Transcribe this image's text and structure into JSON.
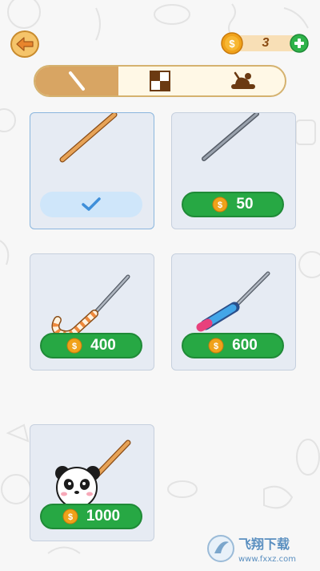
{
  "header": {
    "coin_count": "3"
  },
  "tabs": [
    {
      "icon": "toothpick-icon",
      "active": true
    },
    {
      "icon": "checker-pattern-icon",
      "active": false
    },
    {
      "icon": "food-plate-icon",
      "active": false
    }
  ],
  "items": [
    {
      "name": "wooden-stick",
      "selected": true
    },
    {
      "name": "metal-rod",
      "price": "50"
    },
    {
      "name": "candy-cane-needle",
      "price": "400"
    },
    {
      "name": "pencil-needle",
      "price": "600"
    },
    {
      "name": "panda-stick",
      "price": "1000"
    }
  ],
  "watermark": {
    "text": "飞翔下载",
    "url": "www.fxxz.com"
  },
  "colors": {
    "price_button": "#27a844",
    "coin": "#f0a21a",
    "tab_active": "#d8a563",
    "card_bg": "#e6ebf3"
  }
}
